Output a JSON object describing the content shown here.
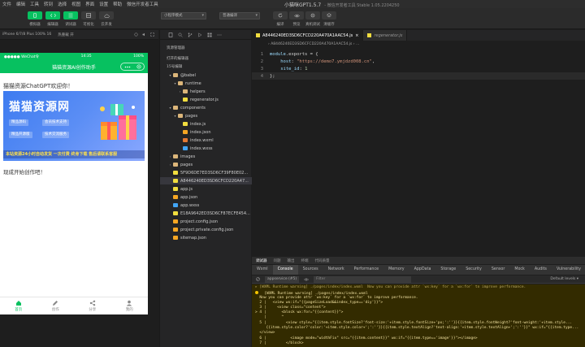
{
  "menubar": {
    "items": [
      "文件",
      "编辑",
      "工具",
      "转到",
      "选择",
      "视图",
      "界面",
      "设置",
      "帮助",
      "微信开发者工具"
    ],
    "title": "小猫咪GPT1.5.7",
    "subtitle": "- 微信开发者工具 Stable 1.05.2204250"
  },
  "toolbar": {
    "labels": [
      "模拟器",
      "编辑器",
      "调试器",
      "可视化",
      "云开发",
      "编译",
      "预览",
      "真机调试",
      "清缓存"
    ],
    "mode_select": "小程序模式",
    "compile_select": "普通编译"
  },
  "simulator": {
    "device": "iPhone 6/7/8 Plus 100% 16",
    "network": "热重载 开",
    "status_carrier": "●●●●● WeChat令",
    "status_time": "14:35",
    "status_battery": "100%",
    "nav_title": "猫猫资源AI创作助手",
    "welcome": "猫猫资源ChatGPT欢迎你！",
    "banner_title": "猫猫资源网",
    "banner_tags": [
      "精品源码",
      "会员技术支持",
      "精品开源版",
      "技术交流服务"
    ],
    "banner_strip": "本站资源24小时自动发货 一次付费 终身下载 售后请联系客服",
    "prompt": "现成开始创作吧！",
    "tabs": [
      "首页",
      "创作",
      "分享",
      "我的"
    ]
  },
  "explorer": {
    "header": "资源管理器",
    "open_editors": "打开的编辑器",
    "project": "15号编辑",
    "tree": [
      {
        "label": "@babel",
        "depth": 1,
        "type": "folder",
        "arrow": "▾"
      },
      {
        "label": "runtime",
        "depth": 2,
        "type": "folder",
        "arrow": "▾"
      },
      {
        "label": "helpers",
        "depth": 3,
        "type": "folder",
        "arrow": "›"
      },
      {
        "label": "regenerator.js",
        "depth": 3,
        "type": "js",
        "arrow": ""
      },
      {
        "label": "components",
        "depth": 1,
        "type": "folder",
        "arrow": "▾"
      },
      {
        "label": "pages",
        "depth": 2,
        "type": "folder",
        "arrow": "▾"
      },
      {
        "label": "index.js",
        "depth": 3,
        "type": "js",
        "arrow": ""
      },
      {
        "label": "index.json",
        "depth": 3,
        "type": "json",
        "arrow": ""
      },
      {
        "label": "index.wxml",
        "depth": 3,
        "type": "wxml",
        "arrow": ""
      },
      {
        "label": "index.wxss",
        "depth": 3,
        "type": "wxss",
        "arrow": ""
      },
      {
        "label": "images",
        "depth": 1,
        "type": "folder",
        "arrow": "›"
      },
      {
        "label": "pages",
        "depth": 1,
        "type": "folder",
        "arrow": "›"
      },
      {
        "label": "5F9D6DE7ED3SD6CF39F80E02...",
        "depth": 1,
        "type": "js",
        "arrow": ""
      },
      {
        "label": "A8446240ED3SD6CFCD220A47...",
        "depth": 1,
        "type": "js",
        "arrow": "",
        "selected": true
      },
      {
        "label": "app.js",
        "depth": 1,
        "type": "js",
        "arrow": ""
      },
      {
        "label": "app.json",
        "depth": 1,
        "type": "json",
        "arrow": ""
      },
      {
        "label": "app.wxss",
        "depth": 1,
        "type": "wxss",
        "arrow": ""
      },
      {
        "label": "E18A9642ED3SD6CF87ECFE454...",
        "depth": 1,
        "type": "js",
        "arrow": ""
      },
      {
        "label": "project.config.json",
        "depth": 1,
        "type": "json",
        "arrow": ""
      },
      {
        "label": "project.private.config.json",
        "depth": 1,
        "type": "json",
        "arrow": ""
      },
      {
        "label": "sitemap.json",
        "depth": 1,
        "type": "json",
        "arrow": ""
      }
    ]
  },
  "editor": {
    "tabs": [
      {
        "label": "A8446240ED3SD6CFCD220A470A1AAC54.js",
        "active": true,
        "close": "×"
      },
      {
        "label": "regenerator.js",
        "active": false,
        "close": ""
      }
    ],
    "breadcrumb": "› A8446240ED3SD6CFCD220A470A1AAC54.js › …",
    "lines": [
      {
        "n": "1",
        "a": "module",
        "b": ".exports = {",
        "c": "",
        "d": ""
      },
      {
        "n": "2",
        "a": "    host",
        "b": ": ",
        "c": "\"https://demo7.ymjdzd008.cn\"",
        "d": ","
      },
      {
        "n": "3",
        "a": "    site_id",
        "b": ": ",
        "c": "",
        "d": "1"
      },
      {
        "n": "4",
        "a": "",
        "b": "};",
        "c": "",
        "d": ""
      }
    ]
  },
  "debugger": {
    "top_tabs": [
      "调试器",
      "问题",
      "输出",
      "终端",
      "代码质量"
    ],
    "tabs": [
      "Wxml",
      "Console",
      "Sources",
      "Network",
      "Performance",
      "Memory",
      "AppData",
      "Storage",
      "Security",
      "Sensor",
      "Mock",
      "Audits",
      "Vulnerability"
    ],
    "active_tab": "Console",
    "context": "appservice (#5)",
    "filter_placeholder": "Filter",
    "levels": "Default levels ▾",
    "console_lines": [
      "▸ [WXML Runtime warning] ./pages/index/index.wxml  Now you can provide attr `wx:key` for a `wx:for` to improve performance.",
      "  [WXML Runtime warning] ./pages/index/index.wxml",
      "  Now you can provide attr `wx:key` for a `wx:for` to improve performance.",
      "  2 |   <view wx:if=\"{{pageSizeLoad&&index_type=='diy'}}\">",
      "  3 |     <view class=\"content\">",
      "> 4 |       <block wx:for=\"{{content}}\">",
      "    |       ^",
      "  5 |         <view style=\"{{item.style.fontSize?'font-size:'+item.style.fontSize+'px;':''}}{{item.style.fontWeight?'font-weight:'+item.style...",
      "     {{item.style.color?'color:'+item.style.color+';':''}}{{item.style.textAlign?'text-align:'+item.style.textAlign+';':''}}\" wx:if=\"{{item.type...",
      "  </view>",
      "  6 |           <image mode=\"widthFix\" src=\"{{item.content}}\" wx:if=\"{{item.type=='image'}}\"></image>",
      "  7 |         </block>"
    ]
  },
  "colors": {
    "brand_green": "#07c160",
    "editor_bg": "#1e1e1e",
    "warning_bg": "#332b00"
  }
}
